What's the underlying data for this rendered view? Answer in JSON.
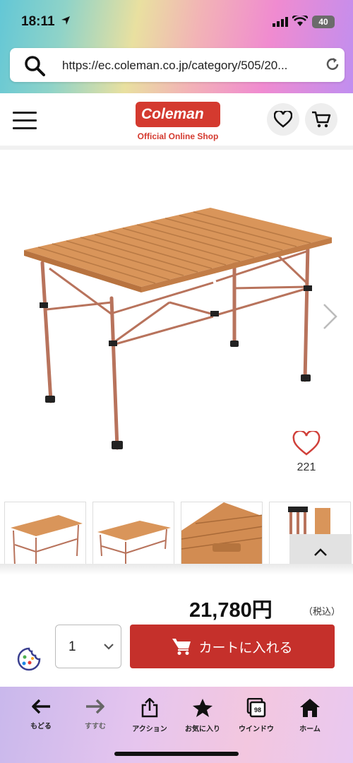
{
  "status_bar": {
    "time": "18:11",
    "battery": "40"
  },
  "browser": {
    "url": "https://ec.coleman.co.jp/category/505/20..."
  },
  "site": {
    "logo_text": "Coleman",
    "logo_sub": "Official Online Shop"
  },
  "product": {
    "favorite_count": "221",
    "price": "21,780円",
    "tax_note": "（税込）"
  },
  "purchase": {
    "quantity": "1",
    "cart_button": "カートに入れる"
  },
  "colors": {
    "brand_red": "#d43a2f",
    "cart_red": "#c5302b"
  },
  "toolbar": {
    "items": [
      {
        "label": "もどる",
        "icon": "back-arrow-icon"
      },
      {
        "label": "すすむ",
        "icon": "forward-arrow-icon"
      },
      {
        "label": "アクション",
        "icon": "share-icon"
      },
      {
        "label": "お気に入り",
        "icon": "star-icon"
      },
      {
        "label": "ウインドウ",
        "icon": "tabs-icon",
        "badge": "98"
      },
      {
        "label": "ホーム",
        "icon": "home-icon"
      }
    ]
  }
}
